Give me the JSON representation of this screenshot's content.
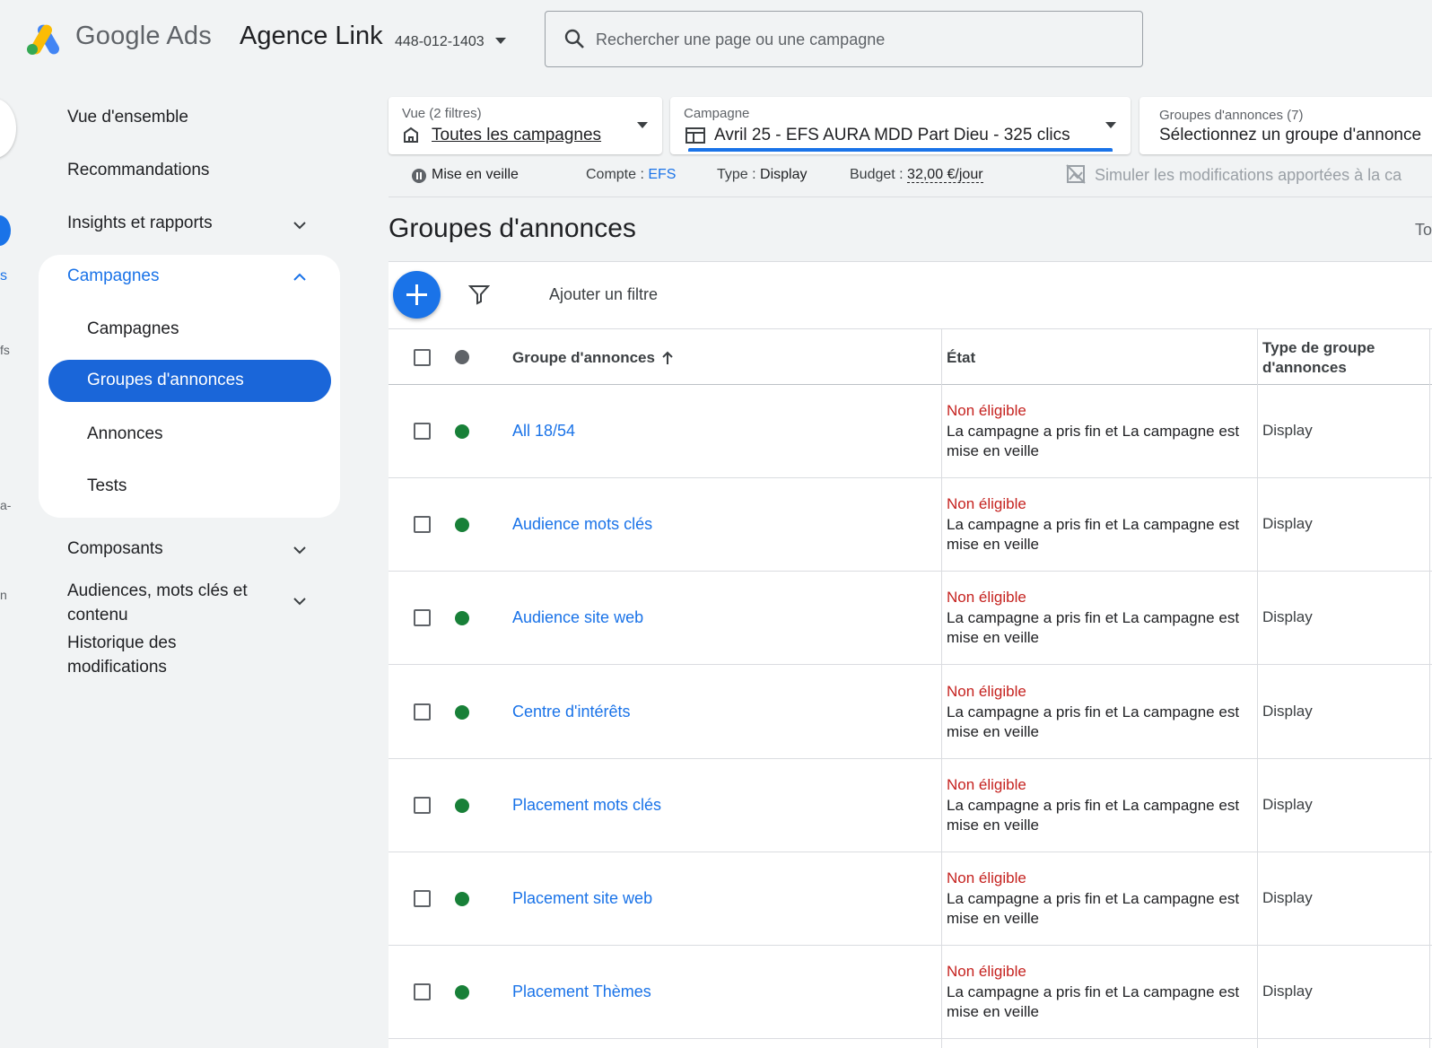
{
  "header": {
    "product_name": "Google Ads",
    "account_name": "Agence Link",
    "account_id": "448-012-1403",
    "search_placeholder": "Rechercher une page ou une campagne"
  },
  "sidebar": {
    "items": [
      {
        "label": "Vue d'ensemble"
      },
      {
        "label": "Recommandations"
      },
      {
        "label": "Insights et rapports"
      },
      {
        "label": "Campagnes"
      },
      {
        "label": "Campagnes"
      },
      {
        "label": "Groupes d'annonces"
      },
      {
        "label": "Annonces"
      },
      {
        "label": "Tests"
      },
      {
        "label": "Composants"
      },
      {
        "label": "Audiences, mots clés et contenu"
      },
      {
        "label": "Historique des modifications"
      }
    ],
    "rail_fragments": [
      "s",
      "fs",
      "a-",
      "n"
    ]
  },
  "filters": {
    "view": {
      "label": "Vue (2 filtres)",
      "value": "Toutes les campagnes"
    },
    "campaign": {
      "label": "Campagne",
      "value": "Avril 25 - EFS AURA MDD Part Dieu - 325 clics"
    },
    "adgroups": {
      "label": "Groupes d'annonces (7)",
      "value": "Sélectionnez un groupe d'annonce"
    }
  },
  "campaign_status": {
    "state": "Mise en veille",
    "account_label": "Compte : ",
    "account_value": "EFS",
    "type_label": "Type : ",
    "type_value": "Display",
    "budget_label": "Budget : ",
    "budget_value": "32,00 €/jour",
    "simulate": "Simuler les modifications apportées à la ca"
  },
  "page": {
    "title": "Groupes d'annonces",
    "right_fragment": "To",
    "add_filter": "Ajouter un filtre"
  },
  "table": {
    "columns": [
      "Groupe d'annonces",
      "État",
      "Type de groupe d'annonces"
    ],
    "rows": [
      {
        "name": "All 18/54",
        "status": "Non éligible",
        "status_detail": "La campagne a pris fin et La campagne est mise en veille",
        "type": "Display"
      },
      {
        "name": "Audience mots clés",
        "status": "Non éligible",
        "status_detail": "La campagne a pris fin et La campagne est mise en veille",
        "type": "Display"
      },
      {
        "name": "Audience site web",
        "status": "Non éligible",
        "status_detail": "La campagne a pris fin et La campagne est mise en veille",
        "type": "Display"
      },
      {
        "name": "Centre d'intérêts",
        "status": "Non éligible",
        "status_detail": "La campagne a pris fin et La campagne est mise en veille",
        "type": "Display"
      },
      {
        "name": "Placement mots clés",
        "status": "Non éligible",
        "status_detail": "La campagne a pris fin et La campagne est mise en veille",
        "type": "Display"
      },
      {
        "name": "Placement site web",
        "status": "Non éligible",
        "status_detail": "La campagne a pris fin et La campagne est mise en veille",
        "type": "Display"
      },
      {
        "name": "Placement Thèmes",
        "status": "Non éligible",
        "status_detail": "La campagne a pris fin et La campagne est mise en veille",
        "type": "Display"
      }
    ]
  },
  "colors": {
    "accent": "#1a73e8",
    "active_nav": "#1a66d9",
    "status_error": "#c5221f",
    "status_enabled": "#188038"
  }
}
